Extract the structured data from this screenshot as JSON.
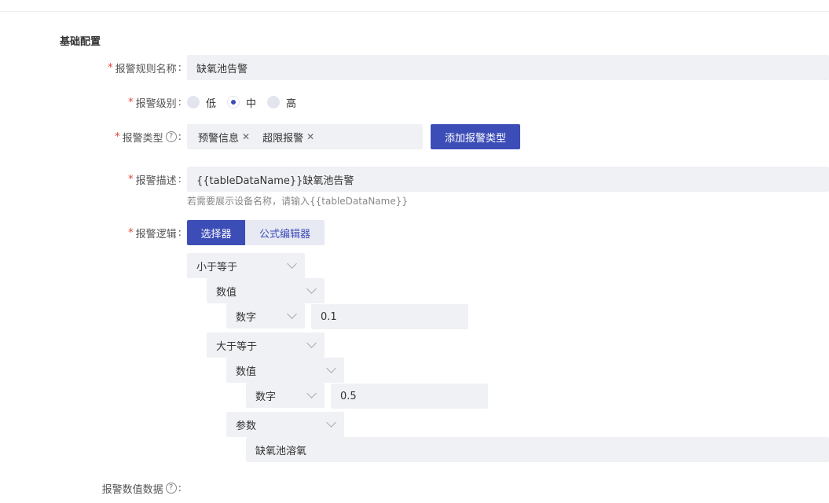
{
  "section": {
    "title": "基础配置"
  },
  "form": {
    "name": {
      "label": "报警规则名称",
      "value": "缺氧池告警"
    },
    "level": {
      "label": "报警级别",
      "options": [
        {
          "label": "低",
          "checked": false
        },
        {
          "label": "中",
          "checked": true
        },
        {
          "label": "高",
          "checked": false
        }
      ]
    },
    "type": {
      "label": "报警类型",
      "help_icon": "question-circle-icon",
      "tags": [
        "预警信息",
        "超限报警"
      ],
      "add_button": "添加报警类型"
    },
    "description": {
      "label": "报警描述",
      "value": "{{tableDataName}}缺氧池告警",
      "hint": "若需要展示设备名称，请输入{{tableDataName}}"
    },
    "logic": {
      "label": "报警逻辑",
      "tabs": [
        "选择器",
        "公式编辑器"
      ],
      "active_tab": "选择器",
      "tree": {
        "op1": "小于等于",
        "op1_val_type": "数值",
        "op1_val_kind": "数字",
        "op1_val_value": "0.1",
        "op2": "大于等于",
        "op2_val_type": "数值",
        "op2_val_kind": "数字",
        "op2_val_value": "0.5",
        "op2_param_type": "参数",
        "op2_param_value": "缺氧池溶氧"
      }
    },
    "value_data": {
      "label": "报警数值数据",
      "help_icon": "question-circle-icon"
    }
  },
  "colors": {
    "primary": "#3d4db7",
    "required": "#e0413b",
    "field_bg": "#f0f1f5"
  }
}
